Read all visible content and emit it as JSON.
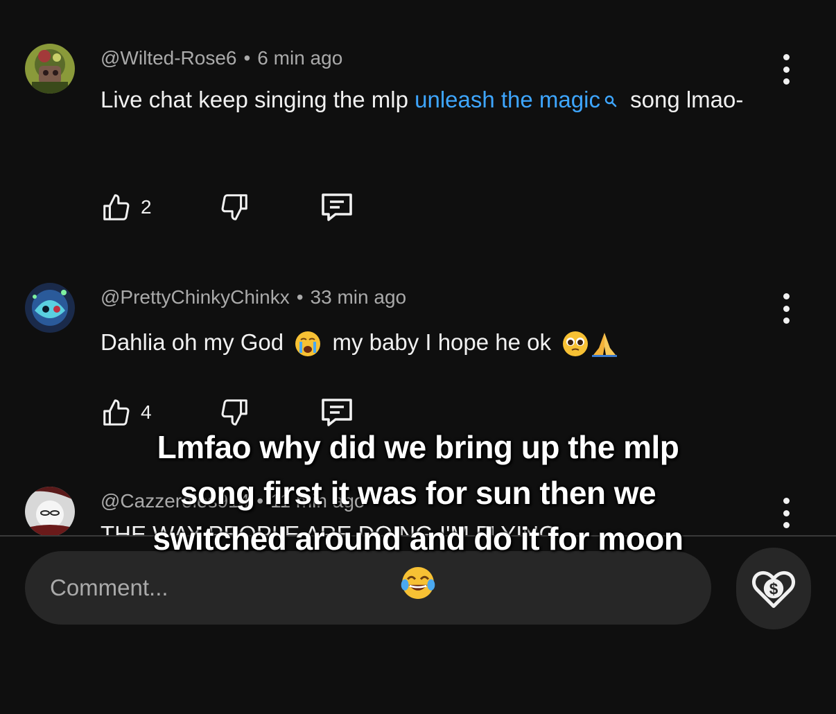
{
  "comments": [
    {
      "author": "@Wilted-Rose6",
      "time": "6 min ago",
      "text_before": "Live chat keep singing the mlp ",
      "link_text": "unleash the magic",
      "text_after": " song lmao-",
      "likes": "2"
    },
    {
      "author": "@PrettyChinkyChinkx",
      "time": "33 min ago",
      "text_part1": "Dahlia oh my God",
      "text_part2": "my baby I hope he ok",
      "likes": "4"
    },
    {
      "author": "@Cazzeroles914",
      "time": "11 min ago",
      "text": "THE WAY PEOPLE ARE DOING I'M FLYING"
    }
  ],
  "composer": {
    "placeholder": "Comment..."
  },
  "caption": {
    "text": "Lmfao why did we bring up the mlp song first it was for sun then we switched around and do it for moon"
  },
  "icons": {
    "like": "thumbs-up-icon",
    "dislike": "thumbs-down-icon",
    "reply": "reply-icon",
    "more": "more-vert-icon",
    "search": "search-icon",
    "thanks": "super-thanks-icon"
  }
}
